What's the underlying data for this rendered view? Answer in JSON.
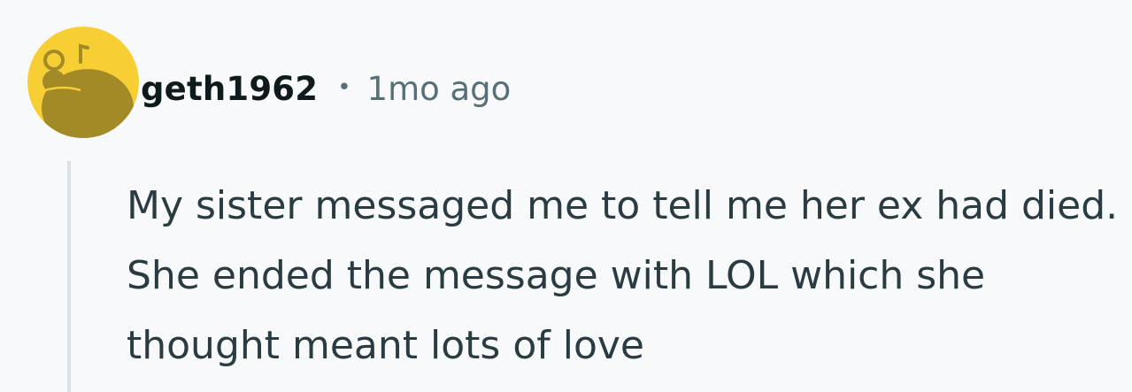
{
  "comment": {
    "avatar": {
      "icon": "reddit-snoo-avatar-icon",
      "background_color": "#f7cf35",
      "figure_color": "#a28a27"
    },
    "username": "geth1962",
    "separator": "•",
    "timestamp": "1mo ago",
    "body": "My sister messaged me to tell me her ex had died. She ended the message with LOL which she thought meant lots of love",
    "colors": {
      "background": "#f7f9fa",
      "username": "#0f1a1c",
      "meta": "#576f76",
      "body_text": "#2a3c42",
      "thread_line": "#d9e2e6"
    }
  }
}
